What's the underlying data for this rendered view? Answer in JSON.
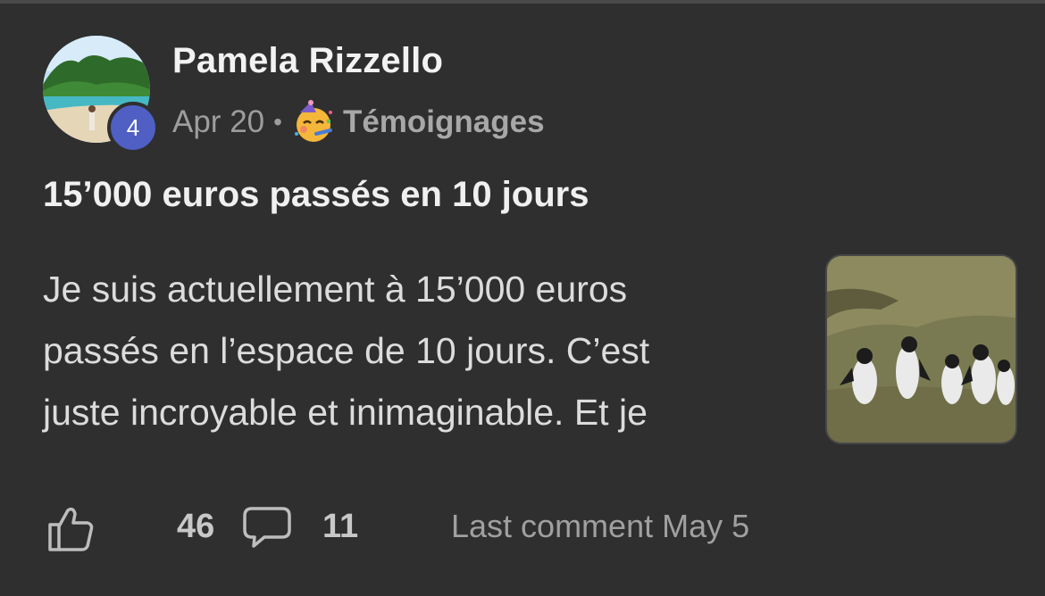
{
  "post": {
    "author": "Pamela Rizzello",
    "badge_level": "4",
    "date": "Apr 20",
    "separator": "•",
    "category": "Témoignages",
    "category_icon": "partying-face-emoji",
    "title": "15’000 euros passés en 10 jours",
    "body_lines": [
      "Je suis actuellement à 15’000 euros",
      "passés en l’espace de 10 jours. C’est",
      "juste incroyable et inimaginable. Et je"
    ],
    "thumbnail": "penguins-image"
  },
  "actions": {
    "likes": "46",
    "comments": "11",
    "last_comment": "Last comment May 5"
  },
  "colors": {
    "background": "#2f2f2f",
    "badge": "#4f5fc4"
  }
}
